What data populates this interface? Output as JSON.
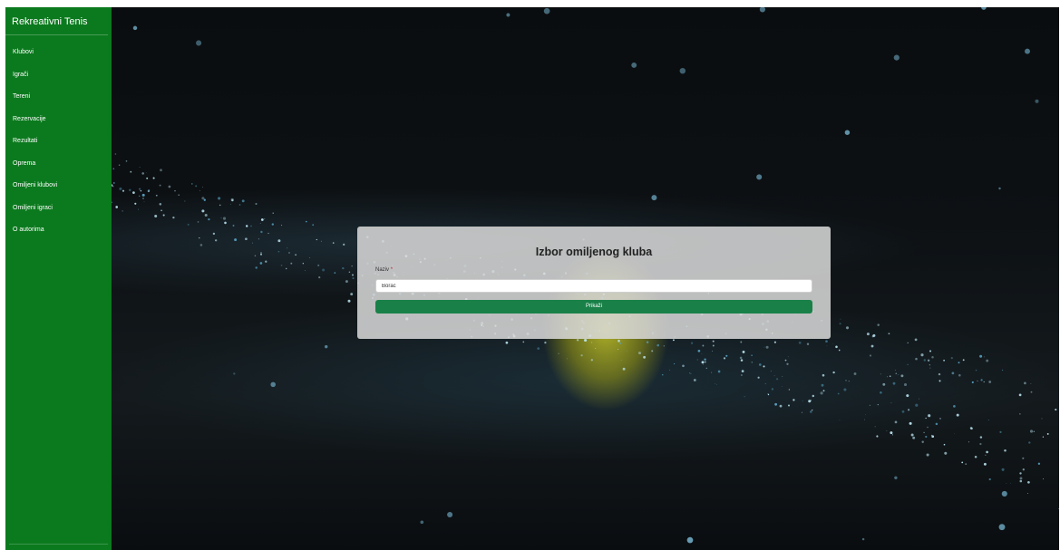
{
  "sidebar": {
    "brand": "Rekreativni Tenis",
    "items": [
      {
        "label": "Klubovi"
      },
      {
        "label": "Igrači"
      },
      {
        "label": "Tereni"
      },
      {
        "label": "Rezervacije"
      },
      {
        "label": "Rezultati"
      },
      {
        "label": "Oprema"
      },
      {
        "label": "Omiljeni klubovi"
      },
      {
        "label": "Omiljeni igraci"
      },
      {
        "label": "O autorima"
      }
    ]
  },
  "form": {
    "title": "Izbor omiljenog kluba",
    "field_label": "Naziv",
    "required_mark": "*",
    "field_value": "Borac",
    "submit_label": "Prikaži"
  },
  "colors": {
    "sidebar": "#0b7a1e",
    "button": "#198148"
  }
}
